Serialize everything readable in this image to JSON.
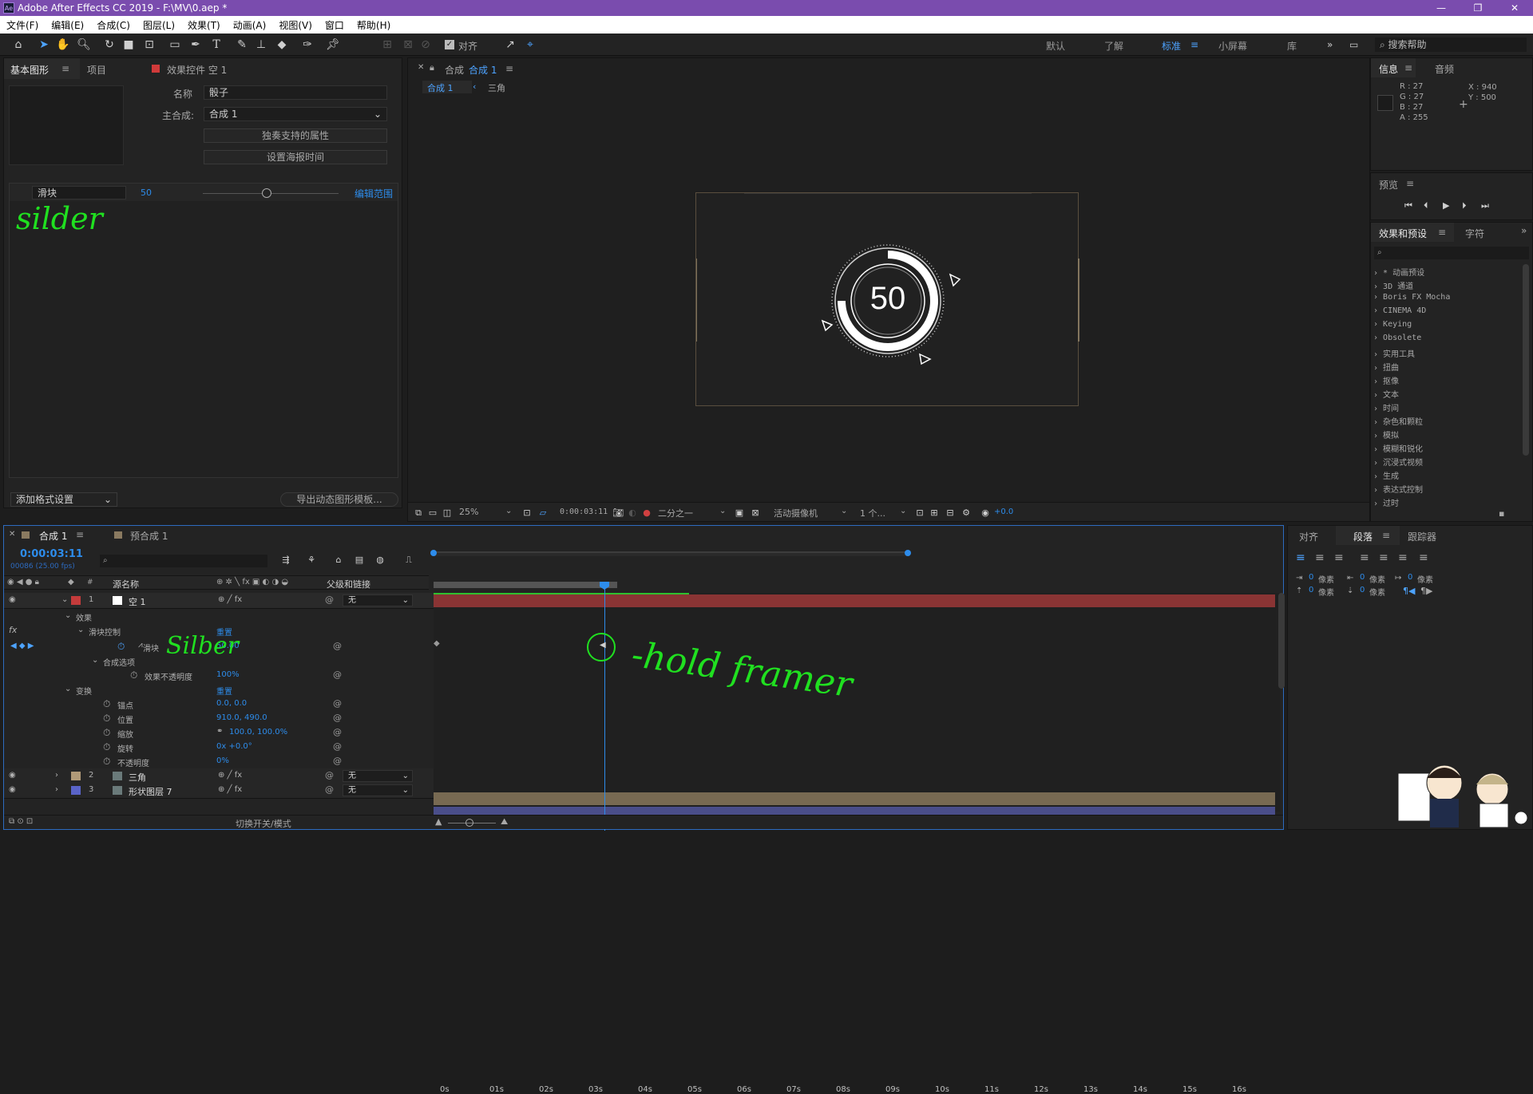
{
  "window": {
    "title": "Adobe After Effects CC 2019 - F:\\MV\\0.aep *",
    "app_icon": "Ae"
  },
  "menu": [
    "文件(F)",
    "编辑(E)",
    "合成(C)",
    "图层(L)",
    "效果(T)",
    "动画(A)",
    "视图(V)",
    "窗口",
    "帮助(H)"
  ],
  "toolbar": {
    "snap_label": "对齐",
    "workspaces": [
      "默认",
      "了解",
      "标准",
      "小屏幕",
      "库"
    ],
    "search_help": "搜索帮助"
  },
  "essential_graphics": {
    "tabs": [
      "基本图形",
      "项目",
      "效果控件 空 1"
    ],
    "name_label": "名称",
    "name_value": "骰子",
    "master_comp_label": "主合成:",
    "master_comp_value": "合成 1",
    "solo_button": "独奏支持的属性",
    "poster_button": "设置海报时间",
    "slider_name": "滑块",
    "slider_value": "50",
    "edit_range": "编辑范围",
    "add_format": "添加格式设置",
    "export_button": "导出动态图形模板..."
  },
  "composition": {
    "tab_label": "合成",
    "tab_comp": "合成 1",
    "breadcrumb": [
      "合成 1",
      "三角"
    ],
    "center_number": "50",
    "zoom": "25%",
    "timecode": "0:00:03:11",
    "resolution": "二分之一",
    "camera": "活动摄像机",
    "views": "1 个...",
    "exposure": "+0.0"
  },
  "info_panel": {
    "tabs": [
      "信息",
      "音频"
    ],
    "r": "R : 27",
    "g": "G : 27",
    "b": "B : 27",
    "a": "A : 255",
    "x": "X : 940",
    "y": "Y : 500"
  },
  "preview_panel": {
    "title": "预览"
  },
  "effects_panel": {
    "tabs": [
      "效果和预设",
      "字符"
    ],
    "items": [
      "* 动画预设",
      "3D 通道",
      "Boris FX Mocha",
      "CINEMA 4D",
      "Keying",
      "Obsolete",
      "实用工具",
      "扭曲",
      "抠像",
      "文本",
      "时间",
      "杂色和颗粒",
      "模拟",
      "模糊和锐化",
      "沉浸式视频",
      "生成",
      "表达式控制",
      "过时"
    ]
  },
  "timeline": {
    "tabs": [
      "合成 1",
      "预合成 1"
    ],
    "timecode": "0:00:03:11",
    "frame_info": "00086 (25.00 fps)",
    "col_source": "源名称",
    "col_parent": "父级和链接",
    "ruler": [
      "0s",
      "01s",
      "02s",
      "03s",
      "04s",
      "05s",
      "06s",
      "07s",
      "08s",
      "09s",
      "10s",
      "11s",
      "12s",
      "13s",
      "14s",
      "15s",
      "16s"
    ],
    "layers": [
      {
        "num": "1",
        "name": "空 1",
        "parent": "无",
        "color": "#c43b3b"
      },
      {
        "num": "2",
        "name": "三角",
        "parent": "无",
        "color": "#b09a78"
      },
      {
        "num": "3",
        "name": "形状图层 7",
        "parent": "无",
        "color": "#5a64c8"
      }
    ],
    "props": {
      "effects": "效果",
      "slider_control": "滑块控制",
      "reset": "重置",
      "slider": "滑块",
      "slider_val": "50.00",
      "comp_options": "合成选项",
      "effect_opacity": "效果不透明度",
      "effect_opacity_val": "100%",
      "transform": "变换",
      "transform_reset": "重置",
      "anchor": "锚点",
      "anchor_val": "0.0, 0.0",
      "position": "位置",
      "position_val": "910.0, 490.0",
      "scale": "缩放",
      "scale_val": "100.0, 100.0%",
      "rotation": "旋转",
      "rotation_val": "0x +0.0°",
      "opacity": "不透明度",
      "opacity_val": "0%"
    },
    "toggle_modes": "切换开关/模式"
  },
  "paragraph_panel": {
    "tabs": [
      "对齐",
      "段落",
      "跟踪器"
    ],
    "px_label": "像素",
    "values": [
      "0",
      "0",
      "0",
      "0",
      "0"
    ]
  },
  "annotations": {
    "slider_note": "silder",
    "slider_note2": "Silber",
    "hold_note": "hold framer"
  }
}
